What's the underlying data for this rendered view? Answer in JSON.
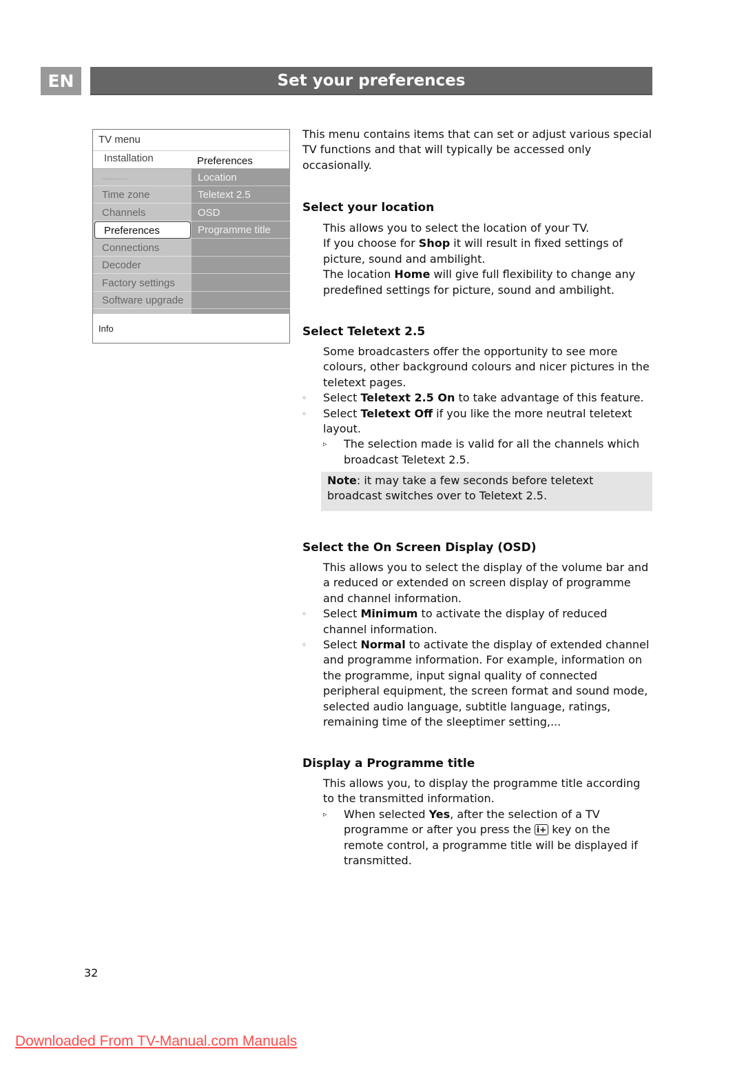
{
  "header": {
    "language_tab": "EN",
    "title": "Set your preferences"
  },
  "tv_menu": {
    "title": "TV menu",
    "breadcrumb_left": "Installation",
    "breadcrumb_right": "Preferences",
    "left_items": [
      {
        "label": "............",
        "selected": false
      },
      {
        "label": "Time zone",
        "selected": false
      },
      {
        "label": "Channels",
        "selected": false
      },
      {
        "label": "Preferences",
        "selected": true
      },
      {
        "label": "Connections",
        "selected": false
      },
      {
        "label": "Decoder",
        "selected": false
      },
      {
        "label": "Factory settings",
        "selected": false
      },
      {
        "label": "Software upgrade",
        "selected": false
      }
    ],
    "right_items": [
      "Location",
      "Teletext 2.5",
      "OSD",
      "Programme title",
      "",
      "",
      "",
      ""
    ],
    "info_label": "Info"
  },
  "intro": "This menu contains items that can set or adjust various special TV functions and that will typically be accessed only occasionally.",
  "sections": {
    "location": {
      "heading": "Select your location",
      "line1": "This allows you to select the location of your TV.",
      "line2_pre": "If you choose for ",
      "line2_bold": "Shop",
      "line2_post": " it will result in fixed settings of picture, sound and ambilight.",
      "line3_pre": "The location ",
      "line3_bold": "Home",
      "line3_post": " will give full flexibility to change any predefined settings for picture, sound and ambilight."
    },
    "teletext": {
      "heading": "Select Teletext 2.5",
      "body": "Some broadcasters offer the opportunity to see more colours, other background colours and nicer pictures in the teletext pages.",
      "bullet1_pre": "Select ",
      "bullet1_bold": "Teletext 2.5 On",
      "bullet1_post": " to take advantage of this feature.",
      "bullet2_pre": "Select ",
      "bullet2_bold": "Teletext Off",
      "bullet2_post": " if you like the more neutral teletext layout.",
      "sub1": "The selection made is valid for all the channels which broadcast Teletext 2.5.",
      "note_bold": "Note",
      "note_text": ": it may take a few seconds before teletext broadcast switches over to Teletext 2.5."
    },
    "osd": {
      "heading": "Select the On Screen Display (OSD)",
      "body": "This allows you to select the display of the volume bar and a reduced or extended on screen display of programme and channel information.",
      "bullet1_pre": "Select ",
      "bullet1_bold": "Minimum",
      "bullet1_post": " to activate the display of reduced channel information.",
      "bullet2_pre": "Select ",
      "bullet2_bold": "Normal",
      "bullet2_post": " to activate the display of extended channel and programme information. For example, information on the programme, input signal quality of connected peripheral equipment, the screen format and sound mode, selected audio language, subtitle language, ratings, remaining time of the sleeptimer setting,..."
    },
    "programme_title": {
      "heading": "Display a Programme title",
      "body": "This allows you, to display the programme title according to the transmitted information.",
      "sub1_pre": "When selected ",
      "sub1_bold": "Yes",
      "sub1_mid": ", after the selection of a TV programme or after you press the ",
      "key_label": "i+",
      "sub1_post": " key on the remote control, a  programme title will be displayed if transmitted."
    }
  },
  "markers": {
    "bullet": "◦",
    "sub": "▹"
  },
  "footer": {
    "page_number": "32",
    "download_link": "Downloaded From TV-Manual.com Manuals"
  }
}
